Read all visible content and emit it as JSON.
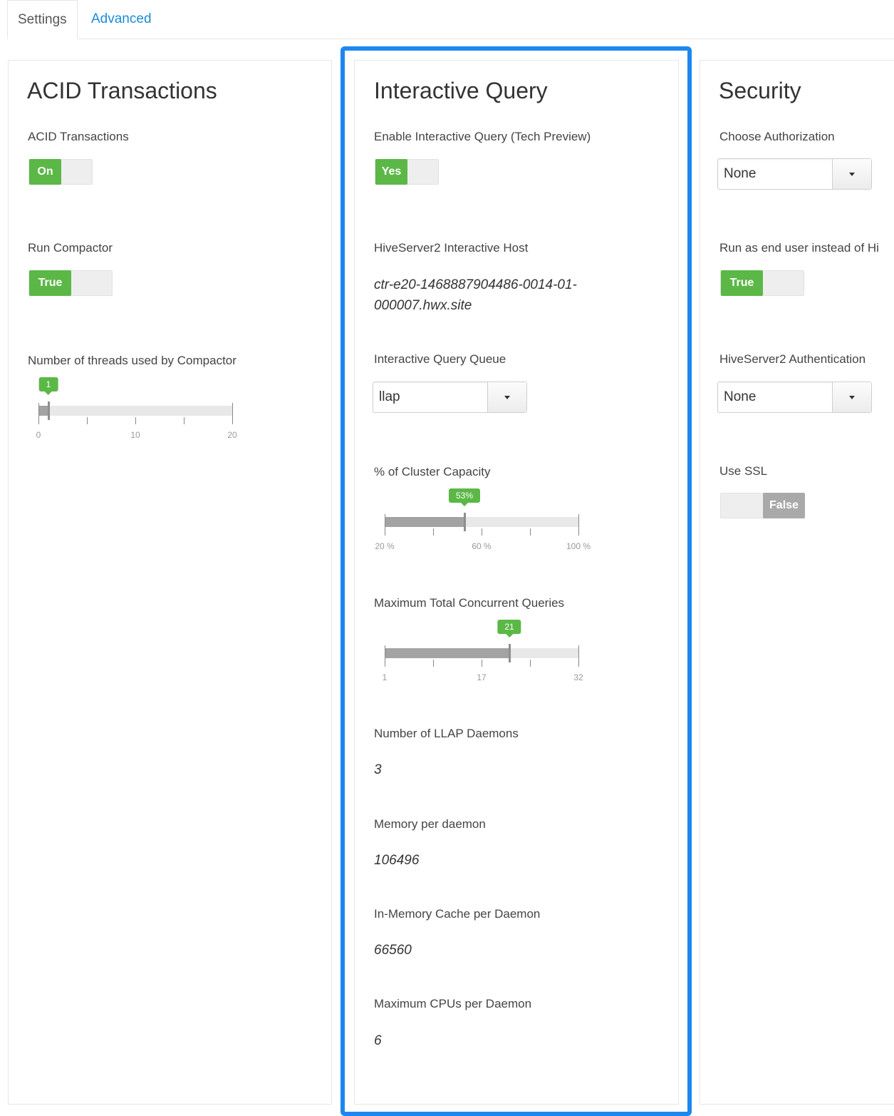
{
  "tabs": {
    "settings": "Settings",
    "advanced": "Advanced"
  },
  "acid": {
    "title": "ACID Transactions",
    "acid_label": "ACID Transactions",
    "acid_toggle": "On",
    "compactor_label": "Run Compactor",
    "compactor_toggle": "True",
    "threads_label": "Number of threads used by Compactor",
    "threads_slider": {
      "value": 1,
      "min": 0,
      "max": 20,
      "badge": "1",
      "tick_labels": [
        "0",
        "10",
        "20"
      ]
    }
  },
  "iq": {
    "title": "Interactive Query",
    "enable_label": "Enable Interactive Query (Tech Preview)",
    "enable_toggle": "Yes",
    "host_label": "HiveServer2 Interactive Host",
    "host_value": "ctr-e20-1468887904486-0014-01-000007.hwx.site",
    "queue_label": "Interactive Query Queue",
    "queue_value": "llap",
    "capacity_label": "% of Cluster Capacity",
    "capacity_slider": {
      "value": 53,
      "min": 20,
      "max": 100,
      "badge": "53%",
      "tick_labels": [
        "20 %",
        "60 %",
        "100 %"
      ]
    },
    "queries_label": "Maximum Total Concurrent Queries",
    "queries_slider": {
      "value": 21,
      "min": 1,
      "max": 32,
      "badge": "21",
      "tick_labels": [
        "1",
        "17",
        "32"
      ]
    },
    "daemons_label": "Number of LLAP Daemons",
    "daemons_value": "3",
    "memory_label": "Memory per daemon",
    "memory_value": "106496",
    "cache_label": "In-Memory Cache per Daemon",
    "cache_value": "66560",
    "cpus_label": "Maximum CPUs per Daemon",
    "cpus_value": "6"
  },
  "security": {
    "title": "Security",
    "auth_label": "Choose Authorization",
    "auth_value": "None",
    "run_as_label": "Run as end user instead of Hi",
    "run_as_toggle": "True",
    "hs2_auth_label": "HiveServer2 Authentication",
    "hs2_auth_value": "None",
    "ssl_label": "Use SSL",
    "ssl_toggle": "False"
  },
  "colors": {
    "accent_green": "#5bb846",
    "highlight_blue": "#1c87f0",
    "link_blue": "#1a8cd8"
  }
}
